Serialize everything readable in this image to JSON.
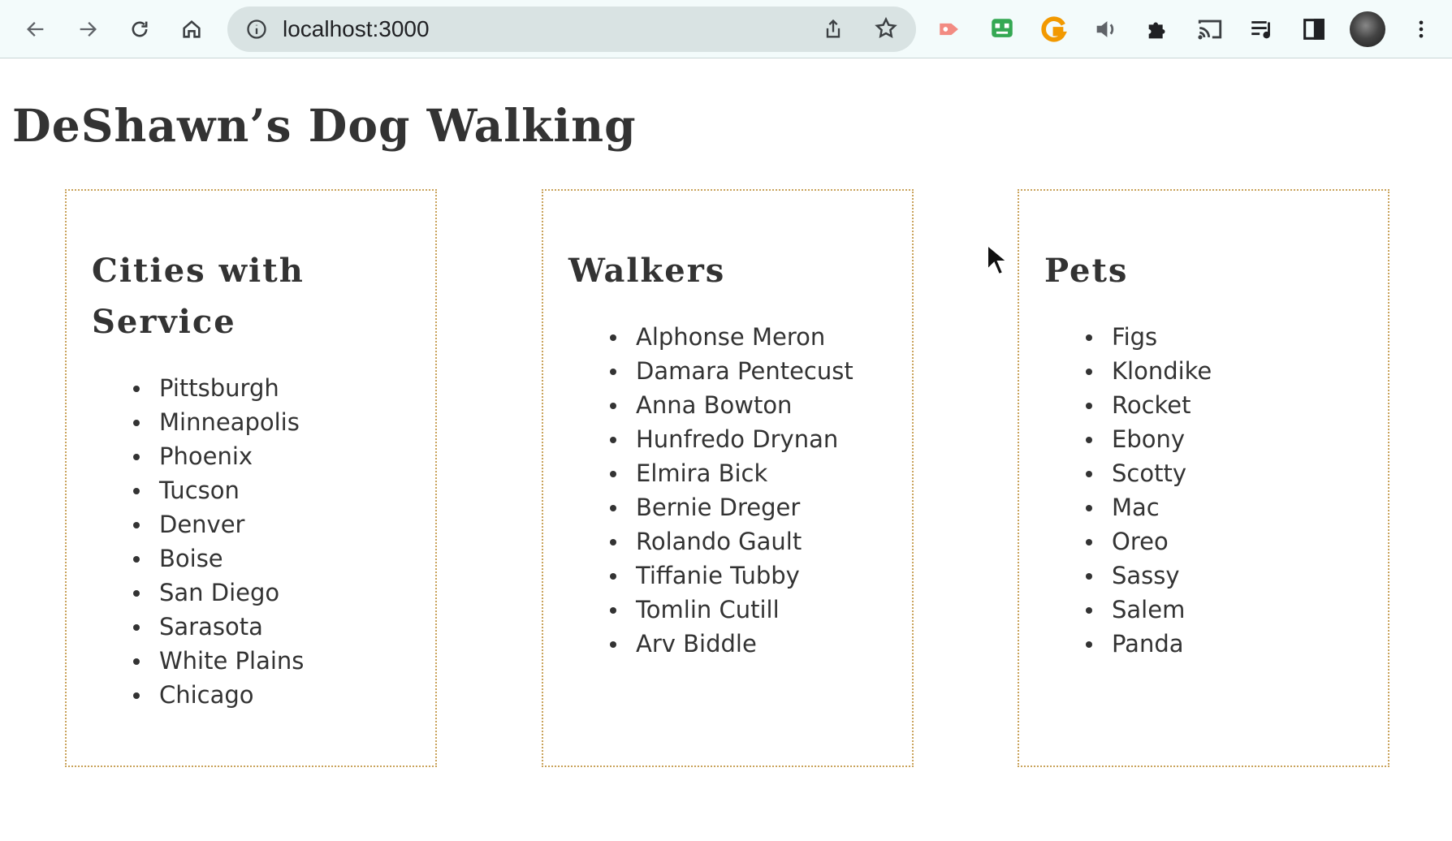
{
  "browser": {
    "url": "localhost:3000",
    "nav_icons": [
      "back-arrow-icon",
      "forward-arrow-icon",
      "reload-icon",
      "home-icon"
    ],
    "extension_icons": [
      "video-record-icon",
      "robot-face-icon",
      "grammar-g-icon",
      "speaker-icon",
      "puzzle-icon",
      "cast-icon",
      "media-queue-icon",
      "side-panel-icon"
    ]
  },
  "page": {
    "title": "DeShawn’s Dog Walking"
  },
  "cities": {
    "heading": "Cities with Service",
    "items": [
      "Pittsburgh",
      "Minneapolis",
      "Phoenix",
      "Tucson",
      "Denver",
      "Boise",
      "San Diego",
      "Sarasota",
      "White Plains",
      "Chicago"
    ]
  },
  "walkers": {
    "heading": "Walkers",
    "items": [
      "Alphonse Meron",
      "Damara Pentecust",
      "Anna Bowton",
      "Hunfredo Drynan",
      "Elmira Bick",
      "Bernie Dreger",
      "Rolando Gault",
      "Tiffanie Tubby",
      "Tomlin Cutill",
      "Arv Biddle"
    ]
  },
  "pets": {
    "heading": "Pets",
    "items": [
      "Figs",
      "Klondike",
      "Rocket",
      "Ebony",
      "Scotty",
      "Mac",
      "Oreo",
      "Sassy",
      "Salem",
      "Panda"
    ]
  },
  "colors": {
    "card_border": "#c9a25a",
    "text": "#333333",
    "toolbar_bg": "#f3fbfb",
    "omnibox_bg": "#d9e3e3"
  }
}
